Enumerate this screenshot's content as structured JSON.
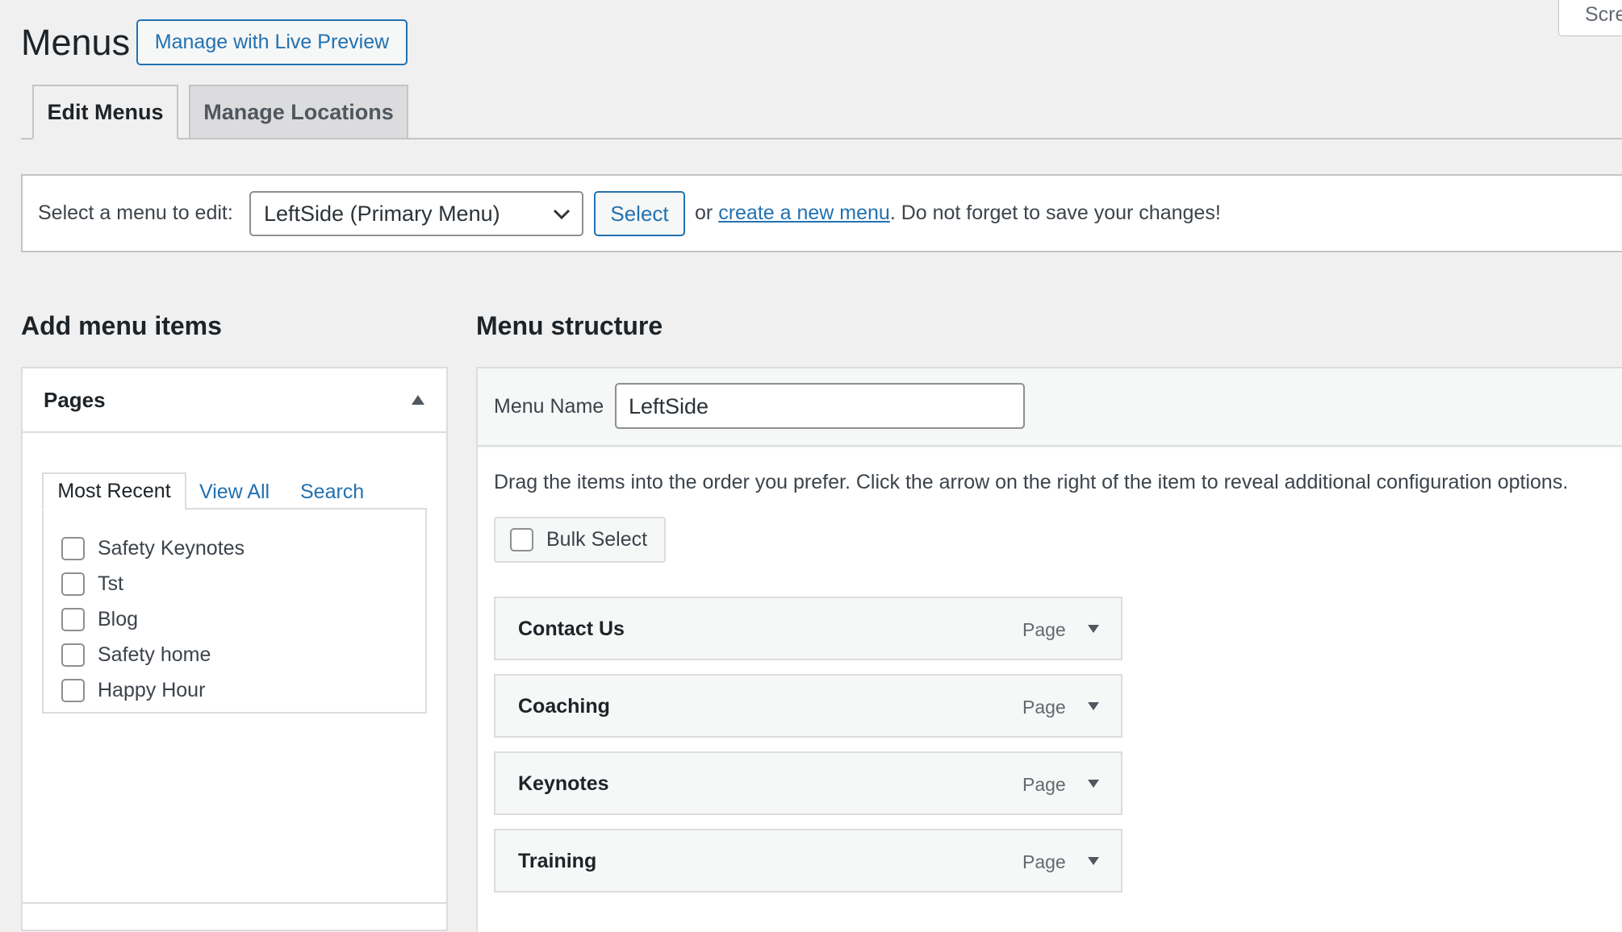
{
  "header": {
    "title": "Menus",
    "live_preview_label": "Manage with Live Preview",
    "screen_options_label": "Scre"
  },
  "tabs": [
    {
      "label": "Edit Menus",
      "active": true
    },
    {
      "label": "Manage Locations",
      "active": false
    }
  ],
  "select_menu": {
    "label": "Select a menu to edit:",
    "selected": "LeftSide (Primary Menu)",
    "button_label": "Select",
    "or_text": "or",
    "create_link": "create a new menu",
    "reminder": ". Do not forget to save your changes!"
  },
  "add_items": {
    "title": "Add menu items",
    "pages_title": "Pages",
    "tabs": [
      "Most Recent",
      "View All",
      "Search"
    ],
    "pages": [
      "Safety Keynotes",
      "Tst",
      "Blog",
      "Safety home",
      "Happy Hour"
    ]
  },
  "structure": {
    "title": "Menu structure",
    "menu_name_label": "Menu Name",
    "menu_name_value": "LeftSide",
    "instructions": "Drag the items into the order you prefer. Click the arrow on the right of the item to reveal additional configuration options.",
    "bulk_select_label": "Bulk Select",
    "items": [
      {
        "title": "Contact Us",
        "type": "Page"
      },
      {
        "title": "Coaching",
        "type": "Page"
      },
      {
        "title": "Keynotes",
        "type": "Page"
      },
      {
        "title": "Training",
        "type": "Page"
      }
    ]
  },
  "colors": {
    "accent": "#2271b1",
    "background": "#f0f0f1",
    "border": "#c3c4c7"
  }
}
